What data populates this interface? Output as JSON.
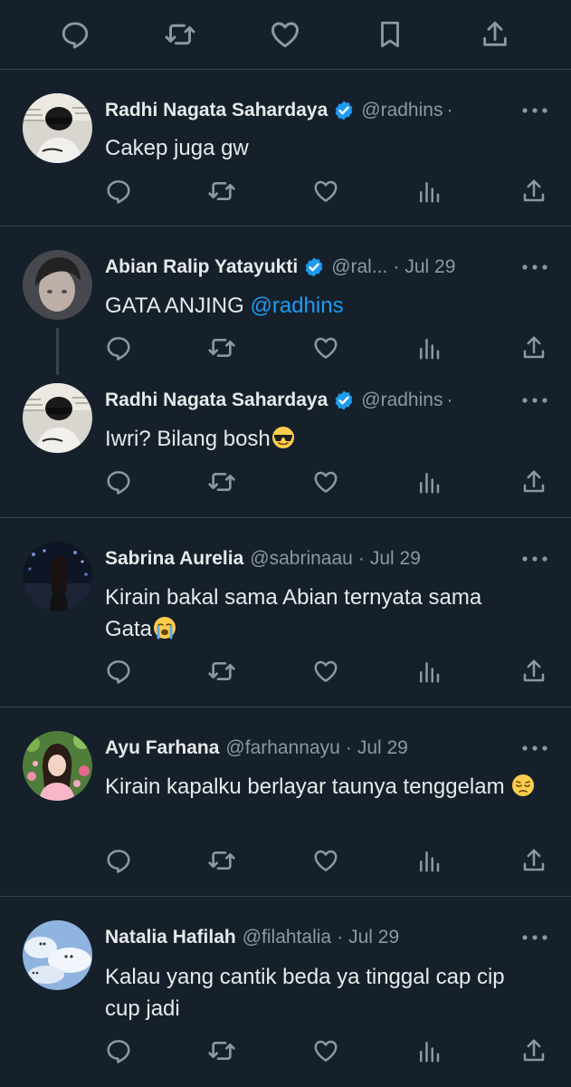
{
  "top_actions": [
    "reply-icon",
    "retweet-icon",
    "like-icon",
    "bookmark-icon",
    "share-icon"
  ],
  "tweets": [
    {
      "name": "Radhi Nagata Sahardaya",
      "verified": true,
      "handle": "@radhins",
      "sep": "·",
      "date": "",
      "text": "Cakep juga gw",
      "mention": "",
      "emoji": ""
    },
    {
      "name": "Abian Ralip Yatayukti",
      "verified": true,
      "handle": "@ral...",
      "sep": "·",
      "date": "Jul 29",
      "text": "GATA ANJING ",
      "mention": "@radhins",
      "emoji": ""
    },
    {
      "name": "Radhi Nagata Sahardaya",
      "verified": true,
      "handle": "@radhins",
      "sep": "·",
      "date": "",
      "text": "Iwri? Bilang bosh",
      "mention": "",
      "emoji": "sunglasses-emoji"
    },
    {
      "name": "Sabrina Aurelia",
      "verified": false,
      "handle": "@sabrinaau",
      "sep": "·",
      "date": "Jul 29",
      "text": "Kirain bakal sama Abian ternyata sama Gata",
      "mention": "",
      "emoji": "crying-emoji"
    },
    {
      "name": "Ayu Farhana",
      "verified": false,
      "handle": "@farhannayu",
      "sep": "·",
      "date": "Jul 29",
      "text": "Kirain kapalku berlayar taunya tenggelam ",
      "mention": "",
      "emoji": "pensive-emoji"
    },
    {
      "name": "Natalia Hafilah",
      "verified": false,
      "handle": "@filahtalia",
      "sep": "·",
      "date": "Jul 29",
      "text": "Kalau yang cantik beda ya tinggal cap cip cup jadi",
      "mention": "",
      "emoji": ""
    }
  ],
  "colors": {
    "background": "#15202b",
    "text": "#e7e9ea",
    "muted": "#8b98a5",
    "accent": "#1d9bf0",
    "divider": "#38444d"
  }
}
